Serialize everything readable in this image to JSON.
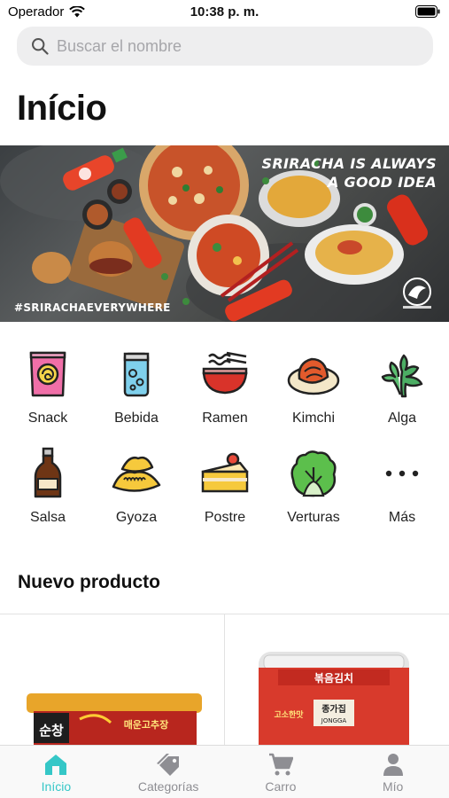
{
  "status_bar": {
    "carrier": "Operador",
    "time": "10:38 p. m."
  },
  "search": {
    "placeholder": "Buscar el nombre",
    "icon": "search-icon"
  },
  "page_title": "Início",
  "banner": {
    "tagline_line1": "SRIRACHA IS ALWAYS",
    "tagline_line2": "A GOOD IDEA",
    "hashtag": "#SRIRACHAEVERYWHERE"
  },
  "categories": [
    {
      "label": "Snack",
      "icon": "snack-bag-icon"
    },
    {
      "label": "Bebida",
      "icon": "drink-can-icon"
    },
    {
      "label": "Ramen",
      "icon": "ramen-bowl-icon"
    },
    {
      "label": "Kimchi",
      "icon": "kimchi-plate-icon"
    },
    {
      "label": "Alga",
      "icon": "seaweed-icon"
    },
    {
      "label": "Salsa",
      "icon": "sauce-bottle-icon"
    },
    {
      "label": "Gyoza",
      "icon": "gyoza-icon"
    },
    {
      "label": "Postre",
      "icon": "cake-slice-icon"
    },
    {
      "label": "Verturas",
      "icon": "lettuce-icon"
    },
    {
      "label": "Más",
      "icon": "more-dots-icon"
    }
  ],
  "new_products": {
    "title": "Nuevo producto",
    "items": [
      {
        "package_text": "순창",
        "package_subtext": "매운고추장"
      },
      {
        "package_text": "볶음김치",
        "package_brand": "종가집",
        "package_brand_en": "JONGGA"
      }
    ]
  },
  "tab_bar": {
    "tabs": [
      {
        "label": "Início",
        "icon": "home-icon",
        "active": true
      },
      {
        "label": "Categorías",
        "icon": "tag-icon",
        "active": false
      },
      {
        "label": "Carro",
        "icon": "cart-icon",
        "active": false
      },
      {
        "label": "Mío",
        "icon": "person-icon",
        "active": false
      }
    ]
  },
  "colors": {
    "accent": "#35c7c7",
    "inactive": "#8e8e93"
  }
}
